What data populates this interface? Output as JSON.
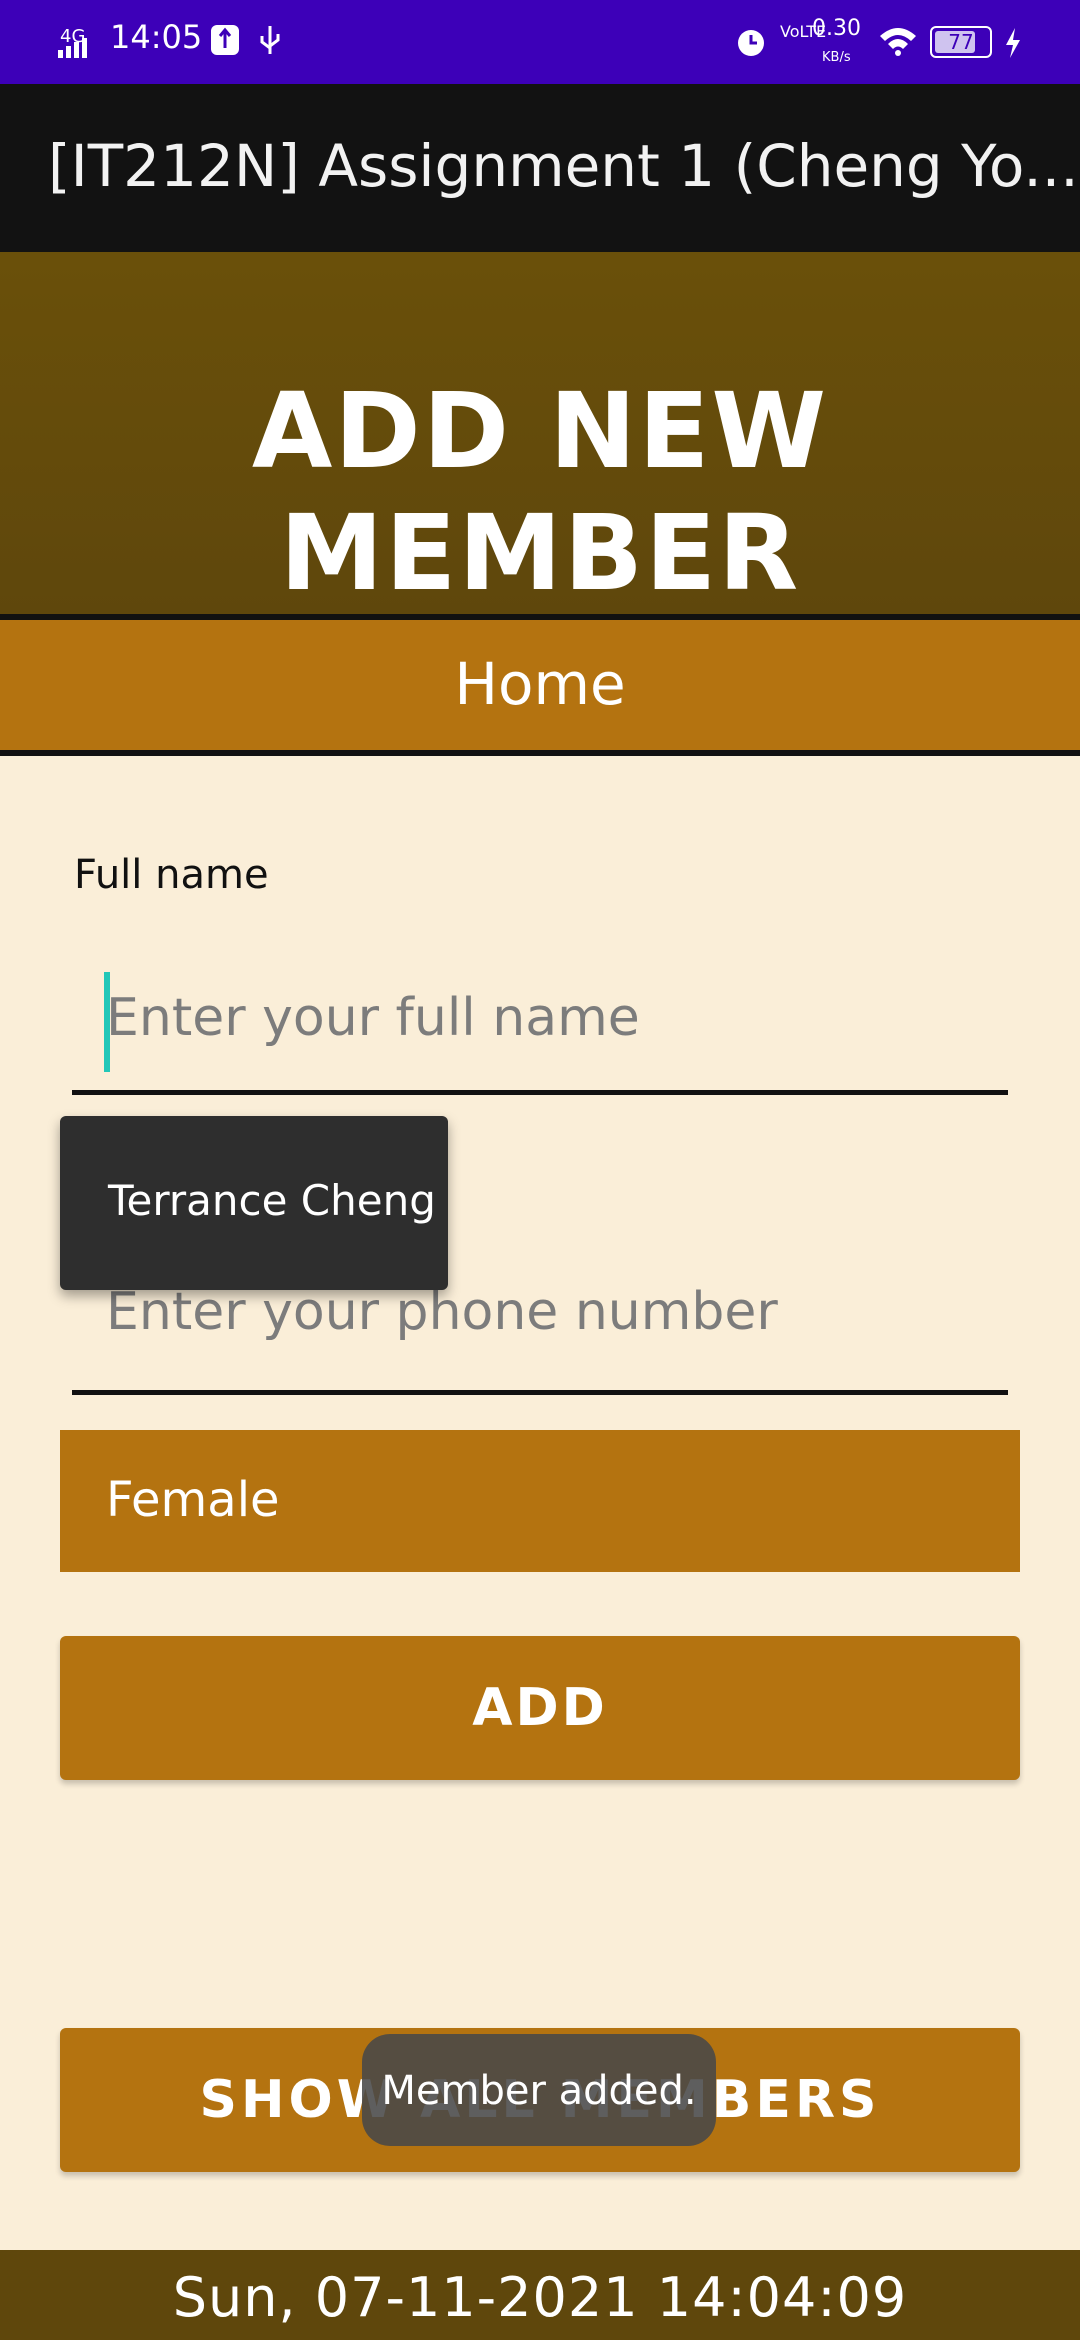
{
  "status_bar": {
    "network": "4G",
    "time": "14:05",
    "data_rate": "0.30",
    "data_rate_unit": "KB/s",
    "volte": "VoLTE",
    "battery": "77"
  },
  "app_bar": {
    "title": "[IT212N] Assignment 1 (Cheng Yo..."
  },
  "header": {
    "title": "ADD NEW MEMBER"
  },
  "nav": {
    "home_label": "Home"
  },
  "form": {
    "full_name_label": "Full name",
    "full_name_placeholder": "Enter your full name",
    "phone_placeholder": "Enter your phone number",
    "gender_selected": "Female",
    "add_label": "ADD",
    "show_all_label": "SHOW ALL MEMBERS"
  },
  "autocomplete": {
    "suggestion": "Terrance Cheng"
  },
  "toast": {
    "message": "Member added."
  },
  "footer": {
    "datetime": "Sun, 07-11-2021  14:04:09"
  },
  "colors": {
    "status_bar": "#3d00b8",
    "app_bar": "#121212",
    "header": "#5f470c",
    "accent": "#b47310",
    "background": "#faeed8"
  }
}
